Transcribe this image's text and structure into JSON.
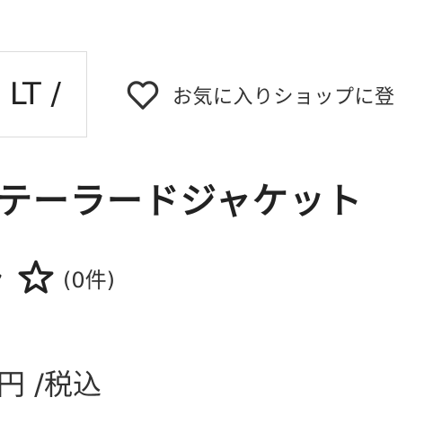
{
  "shop": {
    "name_fragment": "LT /"
  },
  "favorite": {
    "icon": "heart-outline-icon",
    "label": "お気に入りショップに登"
  },
  "product": {
    "title": "テーラードジャケット"
  },
  "rating": {
    "stars_shown": "partial star + empty star",
    "count_text": "(0件)"
  },
  "price": {
    "suffix": "円 /税込"
  },
  "colors": {
    "text": "#222222",
    "border": "#dcdcdc"
  }
}
